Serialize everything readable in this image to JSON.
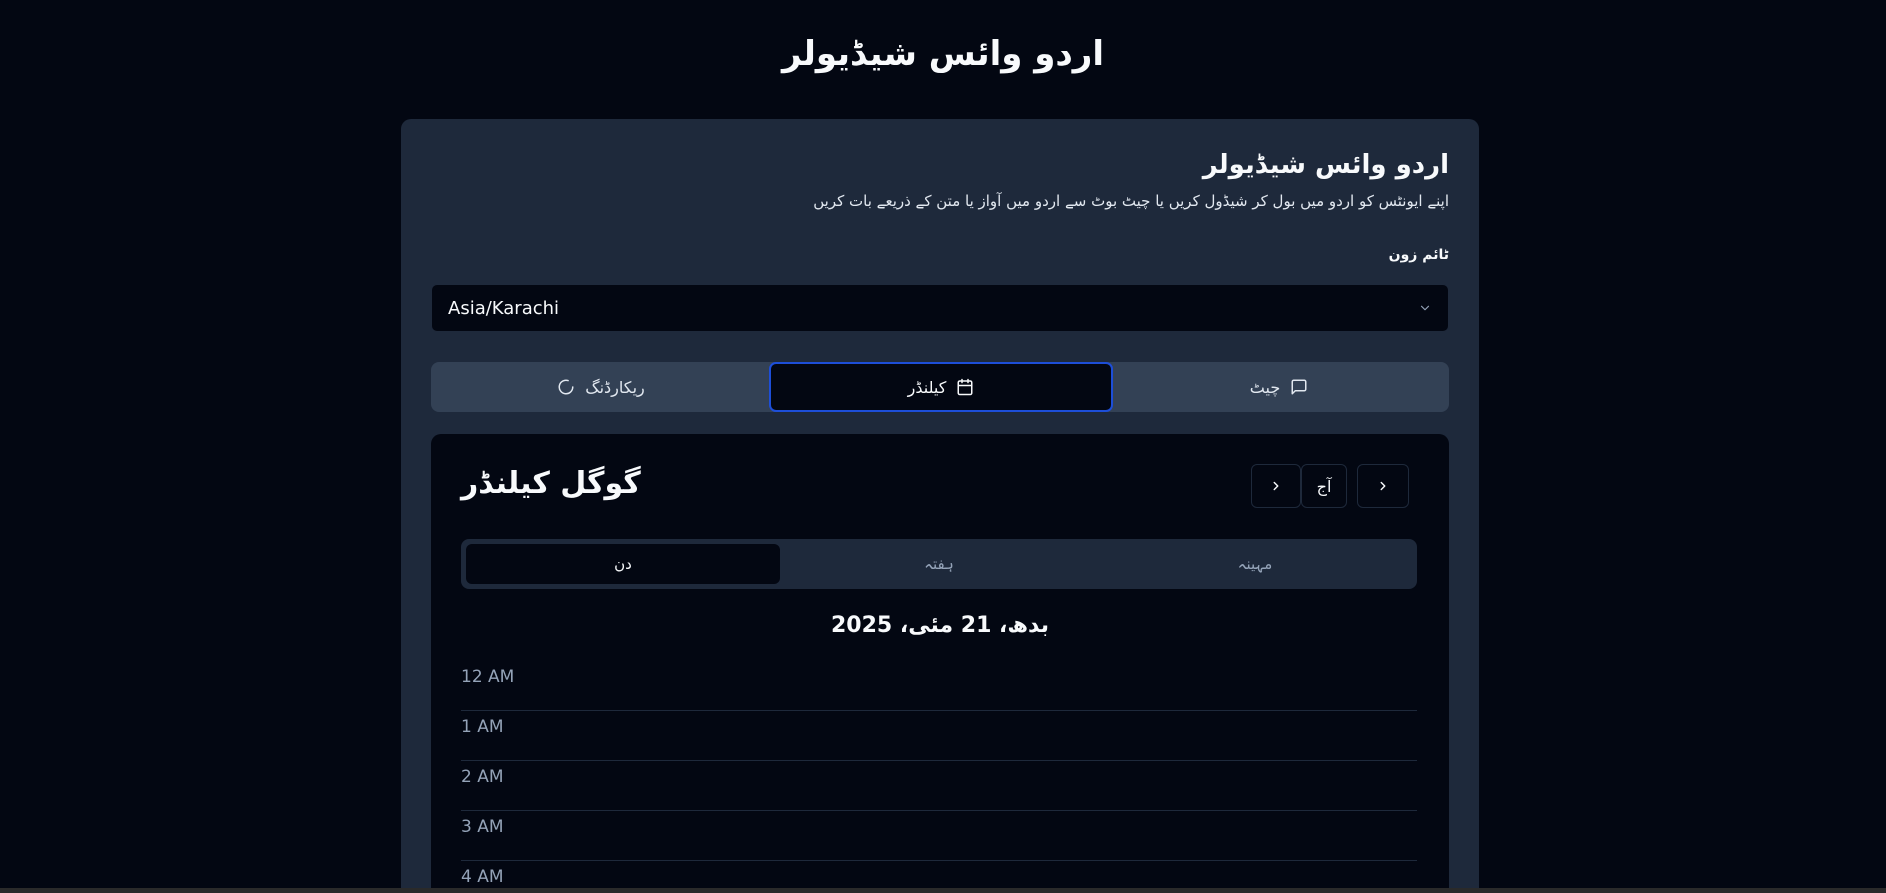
{
  "header": {
    "title": "اردو وائس شیڈیولر"
  },
  "card": {
    "title": "اردو وائس شیڈیولر",
    "subtitle": "اپنے ایونٹس کو اردو میں بول کر شیڈول کریں یا چیٹ بوٹ سے اردو میں آواز یا متن کے ذریعے بات کریں"
  },
  "timezone": {
    "label": "ٹائم زون",
    "value": "Asia/Karachi"
  },
  "tabs": {
    "recording": {
      "label": "ریکارڈنگ",
      "icon": "loader-icon"
    },
    "calendar": {
      "label": "کیلنڈر",
      "icon": "calendar-icon",
      "active": true
    },
    "chat": {
      "label": "چیٹ",
      "icon": "message-square-icon"
    }
  },
  "calendar": {
    "title": "گوگل کیلنڈر",
    "today_label": "آج",
    "views": {
      "day": "دن",
      "week": "ہفتہ",
      "month": "مہینہ",
      "selected": "day"
    },
    "date_heading": "بدھ، 21 مئی، 2025",
    "hours": [
      "12 AM",
      "1 AM",
      "2 AM",
      "3 AM",
      "4 AM"
    ]
  },
  "colors": {
    "background": "#030712",
    "card": "#1e293b",
    "accent": "#1d4ed8",
    "muted_text": "#94a3b8"
  }
}
